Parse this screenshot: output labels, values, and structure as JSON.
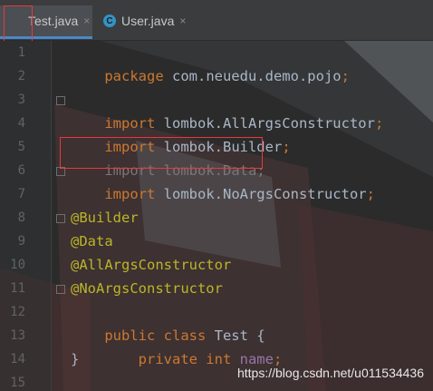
{
  "tabs": [
    {
      "label": "Test.java",
      "close": "×",
      "active": true
    },
    {
      "label": "User.java",
      "close": "×",
      "active": false,
      "icon": "C"
    }
  ],
  "line_numbers": [
    "1",
    "2",
    "3",
    "4",
    "5",
    "6",
    "7",
    "8",
    "9",
    "10",
    "11",
    "12",
    "13",
    "14",
    "15"
  ],
  "code": {
    "l1": {
      "kw": "package",
      "rest": " com.neuedu.demo.pojo",
      "semi": ";"
    },
    "l3": {
      "kw": "import",
      "rest": " lombok.AllArgsConstructor",
      "semi": ";"
    },
    "l4": {
      "kw": "import",
      "rest": " lombok.Builder",
      "semi": ";"
    },
    "l5": {
      "kw": "import",
      "rest": " lombok.Data",
      "semi": ";"
    },
    "l6": {
      "kw": "import",
      "rest": " lombok.NoArgsConstructor",
      "semi": ";"
    },
    "l8": "@Builder",
    "l9": "@Data",
    "l10": "@AllArgsConstructor",
    "l11": "@NoArgsConstructor",
    "l12": {
      "kw": "public class",
      "rest": " Test {"
    },
    "l13": {
      "indent": "    ",
      "kw": "private int",
      "field": " name",
      "semi": ";"
    },
    "l14": "}"
  },
  "watermark": "https://blog.csdn.net/u011534436",
  "colors": {
    "keyword": "#cc7832",
    "annotation": "#bbb529",
    "field": "#9876aa",
    "text": "#a9b7c6",
    "highlight": "#e8383d",
    "tab_underline": "#4a88c7"
  }
}
